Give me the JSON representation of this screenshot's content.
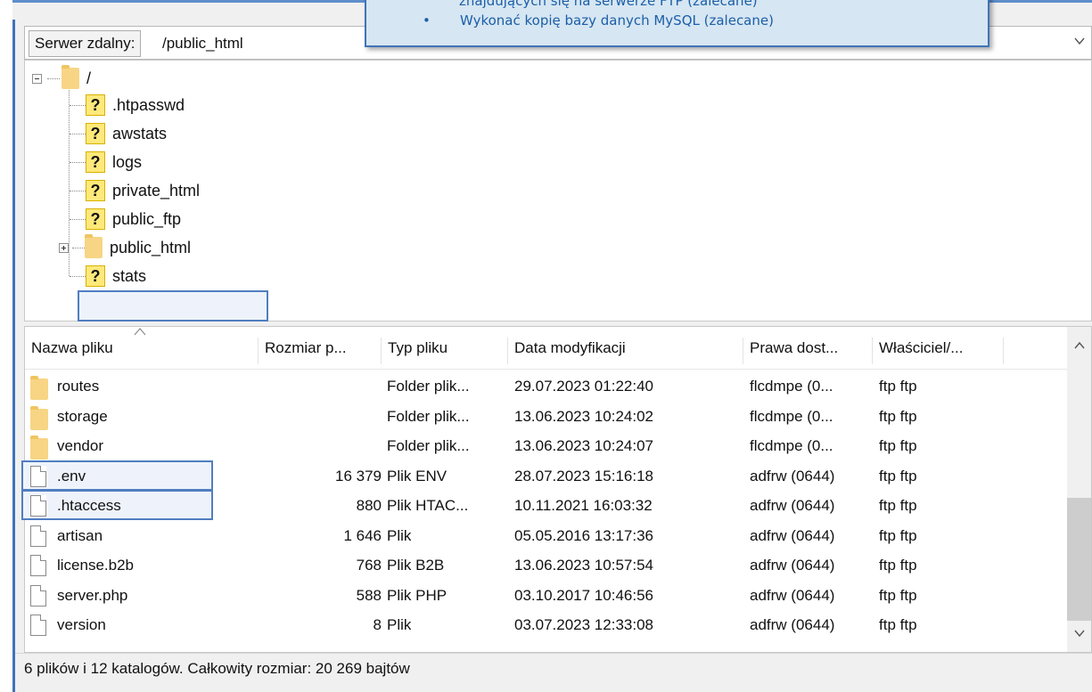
{
  "path_bar": {
    "label": "Serwer zdalny:",
    "value": "/public_html"
  },
  "callout": {
    "line1": "znajdujących się na serwerze FTP (zalecane)",
    "bullet": "•",
    "line2": "Wykonać kopię bazy danych MySQL (zalecane)"
  },
  "tree": {
    "root": "/",
    "items": [
      {
        "name": ".htpasswd",
        "icon": "unknown-icon"
      },
      {
        "name": "awstats",
        "icon": "unknown-icon"
      },
      {
        "name": "logs",
        "icon": "unknown-icon"
      },
      {
        "name": "private_html",
        "icon": "unknown-icon"
      },
      {
        "name": "public_ftp",
        "icon": "unknown-icon"
      },
      {
        "name": "public_html",
        "icon": "folder-icon"
      },
      {
        "name": "stats",
        "icon": "unknown-icon"
      }
    ]
  },
  "list": {
    "columns": [
      "Nazwa pliku",
      "Rozmiar p...",
      "Typ pliku",
      "Data modyfikacji",
      "Prawa dost...",
      "Właściciel/..."
    ],
    "rows": [
      {
        "name": "routes",
        "size": "",
        "type": "Folder plik...",
        "date": "29.07.2023 01:22:40",
        "perm": "flcdmpe (0...",
        "owner": "ftp ftp",
        "icon": "folder-icon"
      },
      {
        "name": "storage",
        "size": "",
        "type": "Folder plik...",
        "date": "13.06.2023 10:24:02",
        "perm": "flcdmpe (0...",
        "owner": "ftp ftp",
        "icon": "folder-icon"
      },
      {
        "name": "vendor",
        "size": "",
        "type": "Folder plik...",
        "date": "13.06.2023 10:24:07",
        "perm": "flcdmpe (0...",
        "owner": "ftp ftp",
        "icon": "folder-icon"
      },
      {
        "name": ".env",
        "size": "16 379",
        "type": "Plik ENV",
        "date": "28.07.2023 15:16:18",
        "perm": "adfrw (0644)",
        "owner": "ftp ftp",
        "icon": "file-icon"
      },
      {
        "name": ".htaccess",
        "size": "880",
        "type": "Plik HTAC...",
        "date": "10.11.2021 16:03:32",
        "perm": "adfrw (0644)",
        "owner": "ftp ftp",
        "icon": "file-icon"
      },
      {
        "name": "artisan",
        "size": "1 646",
        "type": "Plik",
        "date": "05.05.2016 13:17:36",
        "perm": "adfrw (0644)",
        "owner": "ftp ftp",
        "icon": "file-icon"
      },
      {
        "name": "license.b2b",
        "size": "768",
        "type": "Plik B2B",
        "date": "13.06.2023 10:57:54",
        "perm": "adfrw (0644)",
        "owner": "ftp ftp",
        "icon": "file-icon"
      },
      {
        "name": "server.php",
        "size": "588",
        "type": "Plik PHP",
        "date": "03.10.2017 10:46:56",
        "perm": "adfrw (0644)",
        "owner": "ftp ftp",
        "icon": "file-icon"
      },
      {
        "name": "version",
        "size": "8",
        "type": "Plik",
        "date": "03.07.2023 12:33:08",
        "perm": "adfrw (0644)",
        "owner": "ftp ftp",
        "icon": "file-icon"
      }
    ]
  },
  "status": "6 plików i 12 katalogów. Całkowity rozmiar: 20 269 bajtów",
  "colors": {
    "highlight_border": "#4f7ec1",
    "callout_bg": "#d6e6f2",
    "callout_text": "#1c5fa8"
  }
}
